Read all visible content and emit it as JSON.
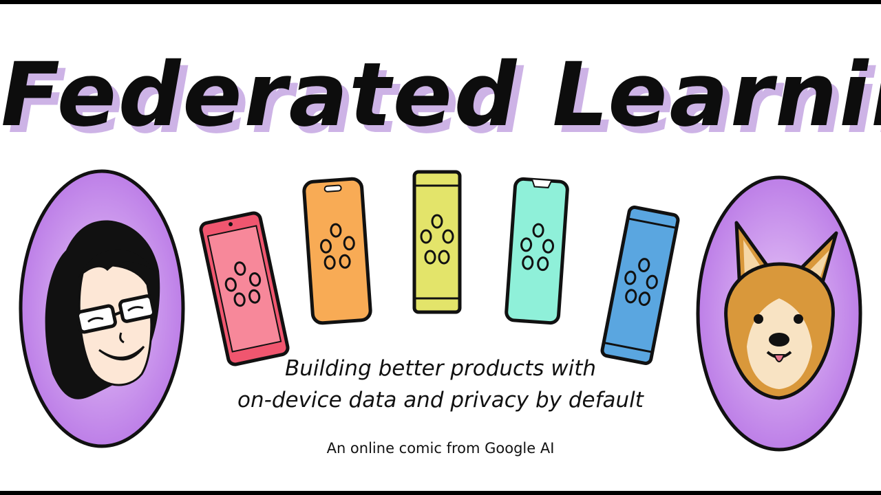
{
  "title": "Federated Learning",
  "subtitle_line1": "Building better products with",
  "subtitle_line2": "on-device data and privacy by default",
  "credit": "An online comic from Google AI",
  "colors": {
    "title_shadow": "#cdb3e6",
    "circle_fill": "#b978e6",
    "phone_red": "#f0566f",
    "phone_orange": "#f8ab55",
    "phone_yellow": "#e3e46a",
    "phone_mint": "#8ff0d9",
    "phone_blue": "#5aa6e0"
  },
  "illustrations": {
    "left_portrait": "woman-with-glasses-icon",
    "right_portrait": "corgi-dog-icon",
    "phones": [
      "phone-icon",
      "phone-icon",
      "phone-icon",
      "phone-icon",
      "phone-icon"
    ]
  }
}
